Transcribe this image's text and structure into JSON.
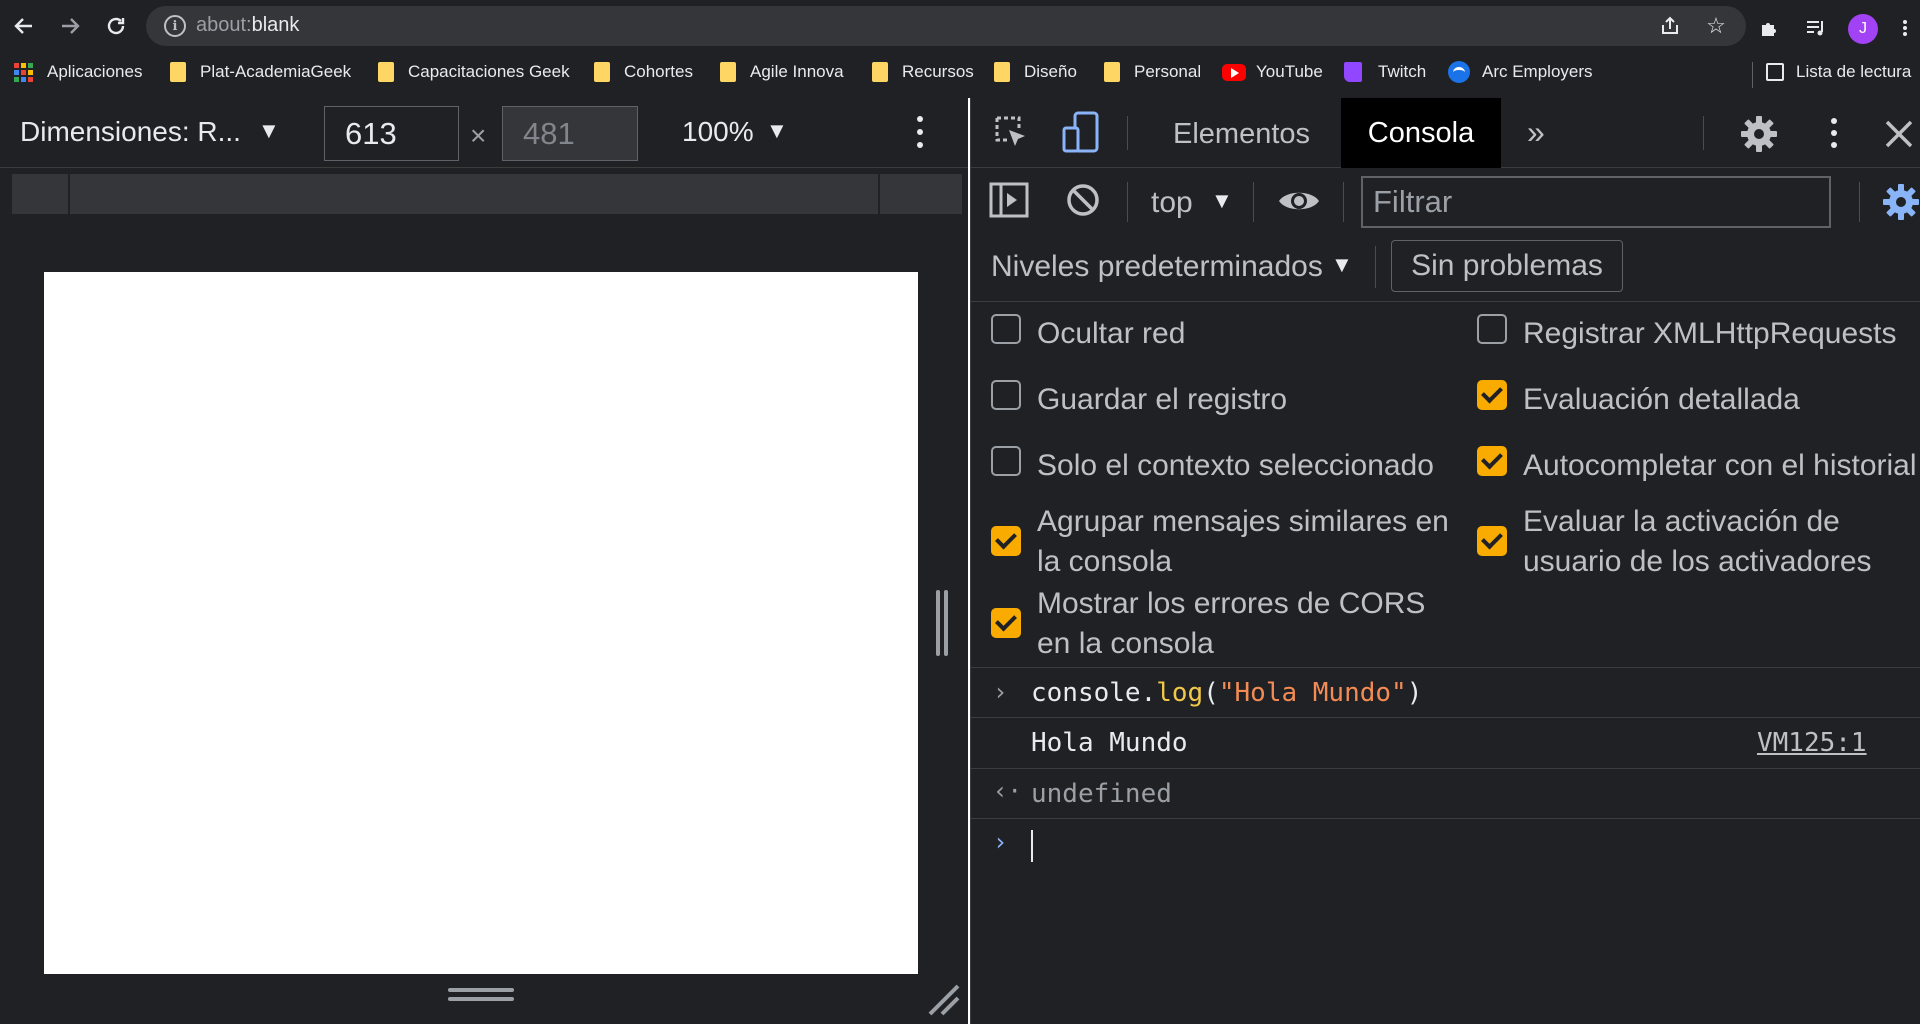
{
  "browser": {
    "url_prefix": "about:",
    "url_host": "blank",
    "avatar_letter": "J",
    "bookmarks": [
      {
        "label": "Aplicaciones",
        "icon": "apps-grid-icon"
      },
      {
        "label": "Plat-AcademiaGeek",
        "icon": "folder-icon"
      },
      {
        "label": "Capacitaciones Geek",
        "icon": "folder-icon"
      },
      {
        "label": "Cohortes",
        "icon": "folder-icon"
      },
      {
        "label": "Agile Innova",
        "icon": "folder-icon"
      },
      {
        "label": "Recursos",
        "icon": "folder-icon"
      },
      {
        "label": "Diseño",
        "icon": "folder-icon"
      },
      {
        "label": "Personal",
        "icon": "folder-icon"
      },
      {
        "label": "YouTube",
        "icon": "youtube-icon"
      },
      {
        "label": "Twitch",
        "icon": "twitch-icon"
      },
      {
        "label": "Arc Employers",
        "icon": "arc-icon"
      }
    ],
    "reading_list": "Lista de lectura"
  },
  "device_toolbar": {
    "dimensions_label": "Dimensiones: R...",
    "width": "613",
    "times": "×",
    "height": "481",
    "zoom": "100%"
  },
  "devtools": {
    "tabs": {
      "elements": "Elementos",
      "console": "Consola",
      "more": "»"
    },
    "context": "top",
    "filter_placeholder": "Filtrar",
    "levels": "Niveles predeterminados",
    "issues": "Sin problemas",
    "options_left": [
      {
        "label": "Ocultar red",
        "checked": false
      },
      {
        "label": "Guardar el registro",
        "checked": false
      },
      {
        "label": "Solo el contexto seleccionado",
        "checked": false
      },
      {
        "label": "Agrupar mensajes similares en la consola",
        "checked": true
      },
      {
        "label": "Mostrar los errores de CORS en la consola",
        "checked": true
      }
    ],
    "options_right": [
      {
        "label": "Registrar XMLHttpRequests",
        "checked": false
      },
      {
        "label": "Evaluación detallada",
        "checked": true
      },
      {
        "label": "Autocompletar con el historial",
        "checked": true
      },
      {
        "label": "Evaluar la activación de usuario de los activadores",
        "checked": true
      }
    ],
    "console": {
      "input_obj": "console.",
      "input_fn": "log",
      "input_open": "(",
      "input_str": "\"Hola Mundo\"",
      "input_close": ")",
      "output": "Hola Mundo",
      "source": "VM125:1",
      "result": "undefined"
    }
  },
  "colors": {
    "checkbox_on": "#f9ab00",
    "devtools_bg": "#202124",
    "accent_blue": "#8ab4f8"
  }
}
